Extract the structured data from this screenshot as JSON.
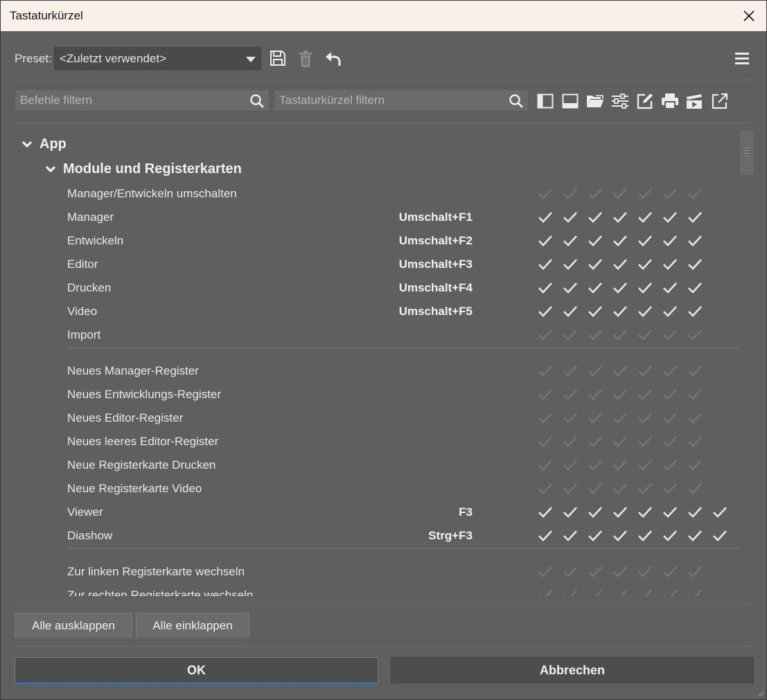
{
  "window": {
    "title": "Tastaturkürzel"
  },
  "toolbar": {
    "preset_label": "Preset:",
    "preset_value": "<Zuletzt verwendet>"
  },
  "filters": {
    "commands_placeholder": "Befehle filtern",
    "shortcuts_placeholder": "Tastaturkürzel filtern"
  },
  "module_icons": [
    "panel-layout-icon",
    "monitor-icon",
    "folder-icon",
    "sliders-icon",
    "edit-icon",
    "printer-icon",
    "video-icon",
    "export-icon"
  ],
  "tree": {
    "group1": "App",
    "group2": "Module und Registerkarten",
    "rows": [
      {
        "label": "Manager/Entwickeln umschalten",
        "key": "",
        "checks": 7,
        "enabled": false
      },
      {
        "label": "Manager",
        "key": "Umschalt+F1",
        "checks": 7,
        "enabled": true
      },
      {
        "label": "Entwickeln",
        "key": "Umschalt+F2",
        "checks": 7,
        "enabled": true
      },
      {
        "label": "Editor",
        "key": "Umschalt+F3",
        "checks": 7,
        "enabled": true
      },
      {
        "label": "Drucken",
        "key": "Umschalt+F4",
        "checks": 7,
        "enabled": true
      },
      {
        "label": "Video",
        "key": "Umschalt+F5",
        "checks": 7,
        "enabled": true
      },
      {
        "label": "Import",
        "key": "",
        "checks": 7,
        "enabled": false
      },
      {
        "label": "Neues Manager-Register",
        "key": "",
        "checks": 7,
        "enabled": false
      },
      {
        "label": "Neues Entwicklungs-Register",
        "key": "",
        "checks": 7,
        "enabled": false
      },
      {
        "label": "Neues Editor-Register",
        "key": "",
        "checks": 7,
        "enabled": false
      },
      {
        "label": "Neues leeres Editor-Register",
        "key": "",
        "checks": 7,
        "enabled": false
      },
      {
        "label": "Neue Registerkarte Drucken",
        "key": "",
        "checks": 7,
        "enabled": false
      },
      {
        "label": "Neue Registerkarte Video",
        "key": "",
        "checks": 7,
        "enabled": false
      },
      {
        "label": "Viewer",
        "key": "F3",
        "checks": 8,
        "enabled": true
      },
      {
        "label": "Diashow",
        "key": "Strg+F3",
        "checks": 8,
        "enabled": true
      },
      {
        "label": "Zur linken Registerkarte wechseln",
        "key": "",
        "checks": 7,
        "enabled": false
      },
      {
        "label": "Zur rechten Registerkarte wechseln",
        "key": "",
        "checks": 7,
        "enabled": false
      }
    ]
  },
  "buttons": {
    "expand_all": "Alle ausklappen",
    "collapse_all": "Alle einklappen",
    "ok": "OK",
    "cancel": "Abbrechen"
  }
}
